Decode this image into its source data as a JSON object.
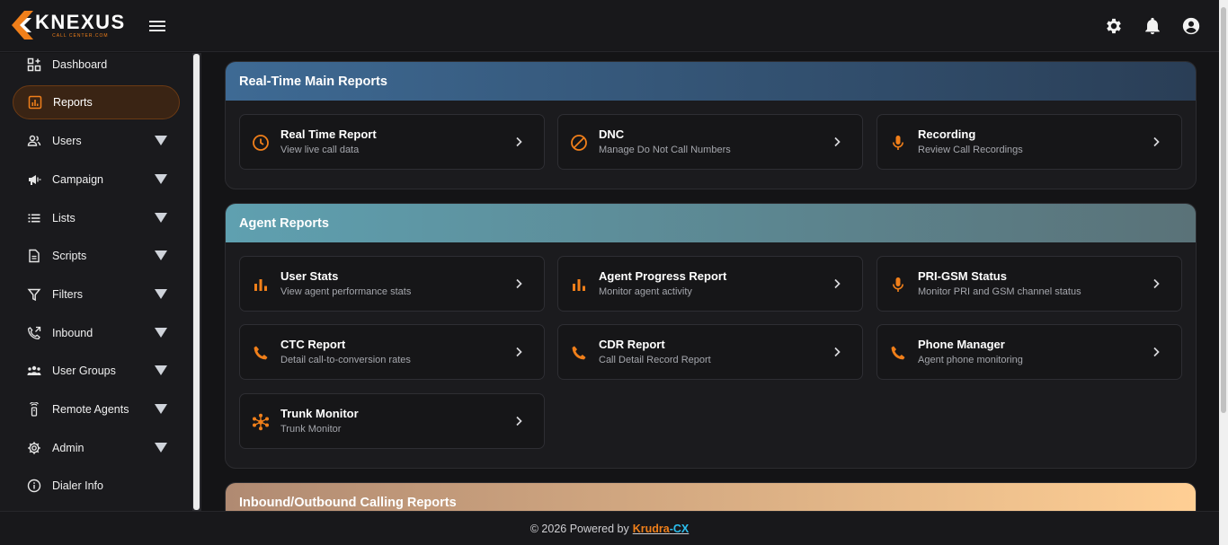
{
  "brand": {
    "word": "KNEXUS",
    "sub": "CALL CENTER.COM",
    "accent": "#f07f1a"
  },
  "sidebar": {
    "items": [
      {
        "label": "Dashboard",
        "icon": "dashboard-icon",
        "caret": false,
        "active": false
      },
      {
        "label": "Reports",
        "icon": "bar-chart-icon",
        "caret": false,
        "active": true
      },
      {
        "label": "Users",
        "icon": "users-icon",
        "caret": true,
        "active": false
      },
      {
        "label": "Campaign",
        "icon": "megaphone-icon",
        "caret": true,
        "active": false
      },
      {
        "label": "Lists",
        "icon": "list-icon",
        "caret": true,
        "active": false
      },
      {
        "label": "Scripts",
        "icon": "document-icon",
        "caret": true,
        "active": false
      },
      {
        "label": "Filters",
        "icon": "filter-icon",
        "caret": true,
        "active": false
      },
      {
        "label": "Inbound",
        "icon": "phone-forward-icon",
        "caret": true,
        "active": false
      },
      {
        "label": "User Groups",
        "icon": "groups-icon",
        "caret": true,
        "active": false
      },
      {
        "label": "Remote Agents",
        "icon": "remote-icon",
        "caret": true,
        "active": false
      },
      {
        "label": "Admin",
        "icon": "gear-icon",
        "caret": true,
        "active": false
      },
      {
        "label": "Dialer Info",
        "icon": "info-icon",
        "caret": false,
        "active": false
      }
    ]
  },
  "sections": [
    {
      "title": "Real-Time Main Reports",
      "gradient": [
        "#3e6a94",
        "#2a3e56"
      ],
      "cards": [
        {
          "title": "Real Time Report",
          "sub": "View live call data",
          "icon": "clock-icon"
        },
        {
          "title": "DNC",
          "sub": "Manage Do Not Call Numbers",
          "icon": "block-icon"
        },
        {
          "title": "Recording",
          "sub": "Review Call Recordings",
          "icon": "microphone-icon"
        }
      ]
    },
    {
      "title": "Agent Reports",
      "gradient": [
        "#5fa0b0",
        "#5a7278"
      ],
      "cards": [
        {
          "title": "User Stats",
          "sub": "View agent performance stats",
          "icon": "bar-chart-icon"
        },
        {
          "title": "Agent Progress Report",
          "sub": "Monitor agent activity",
          "icon": "bar-chart-icon"
        },
        {
          "title": "PRI-GSM Status",
          "sub": "Monitor PRI and GSM channel status",
          "icon": "microphone-icon"
        },
        {
          "title": "CTC Report",
          "sub": "Detail call-to-conversion rates",
          "icon": "phone-icon"
        },
        {
          "title": "CDR Report",
          "sub": "Call Detail Record Report",
          "icon": "phone-icon"
        },
        {
          "title": "Phone Manager",
          "sub": "Agent phone monitoring",
          "icon": "phone-icon"
        },
        {
          "title": "Trunk Monitor",
          "sub": "Trunk Monitor",
          "icon": "hub-icon"
        }
      ]
    },
    {
      "title": "Inbound/Outbound Calling Reports",
      "gradient": [
        "#b08a72",
        "#ffcf94"
      ],
      "cards": []
    }
  ],
  "footer": {
    "prefix": "© 2026 Powered by",
    "brand_a": "Krudra",
    "sep": "-",
    "brand_b": "CX"
  }
}
